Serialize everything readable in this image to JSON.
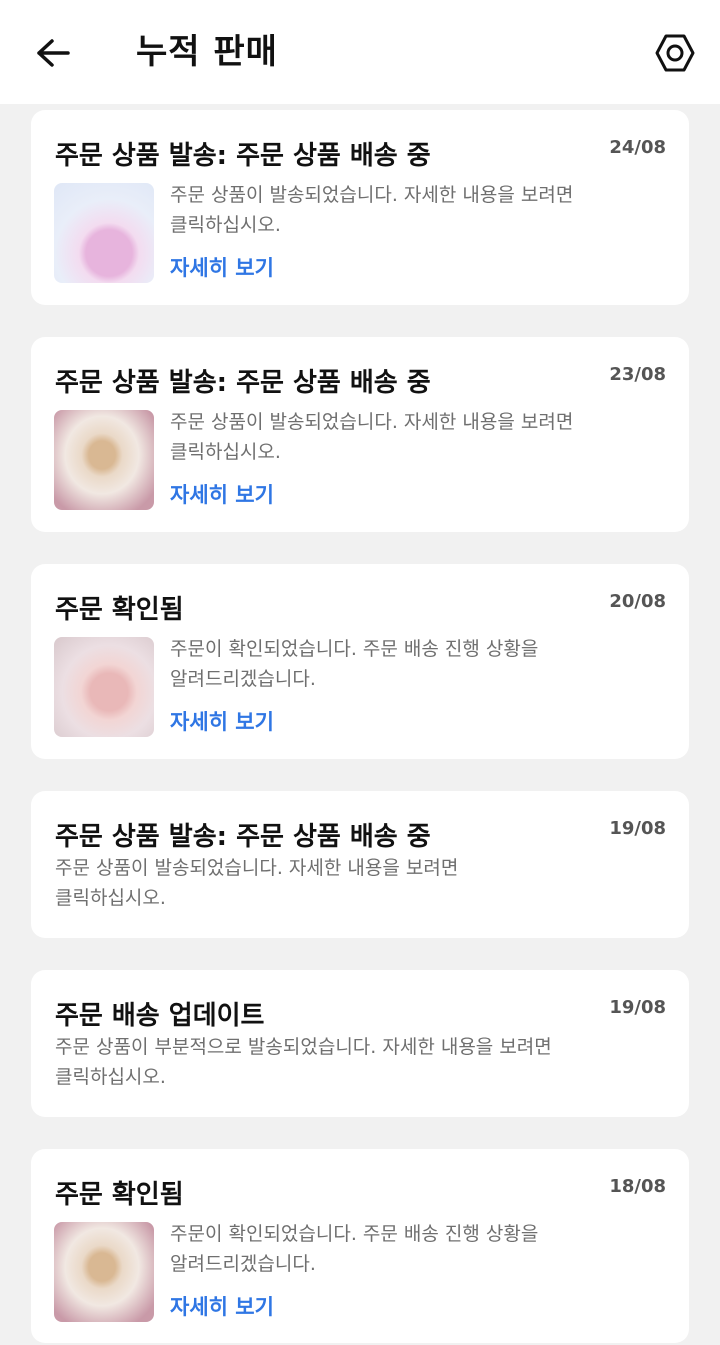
{
  "header": {
    "title": "누적 판매",
    "back_icon": "arrow-left-icon",
    "settings_icon": "hexagon-gear-icon"
  },
  "notifications": [
    {
      "title": "주문 상품 발송: 주문 상품 배송 중",
      "date": "24/08",
      "message": "주문 상품이 발송되었습니다. 자세한 내용을 보려면\n클릭하십시오.",
      "link": "자세히 보기",
      "has_thumbnail": true
    },
    {
      "title": "주문 상품 발송: 주문 상품 배송 중",
      "date": "23/08",
      "message": "주문 상품이 발송되었습니다. 자세한 내용을 보려면\n클릭하십시오.",
      "link": "자세히 보기",
      "has_thumbnail": true
    },
    {
      "title": "주문 확인됨",
      "date": "20/08",
      "message": "주문이 확인되었습니다. 주문 배송 진행 상황을\n알려드리겠습니다.",
      "link": "자세히 보기",
      "has_thumbnail": true
    },
    {
      "title": "주문 상품 발송: 주문 상품 배송 중",
      "date": "19/08",
      "message": "주문 상품이 발송되었습니다. 자세한 내용을 보려면\n클릭하십시오.",
      "has_thumbnail": false
    },
    {
      "title": "주문 배송 업데이트",
      "date": "19/08",
      "message": "주문 상품이 부분적으로 발송되었습니다. 자세한 내용을 보려면\n클릭하십시오.",
      "has_thumbnail": false
    },
    {
      "title": "주문 확인됨",
      "date": "18/08",
      "message": "주문이 확인되었습니다. 주문 배송 진행 상황을\n알려드리겠습니다.",
      "link": "자세히 보기",
      "has_thumbnail": true
    }
  ],
  "colors": {
    "link": "#2f76e4",
    "background": "#f1f1f1",
    "card": "#ffffff"
  }
}
